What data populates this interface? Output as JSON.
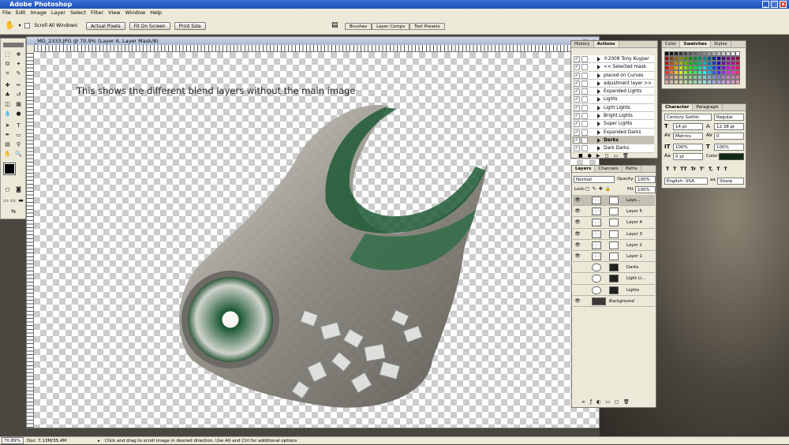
{
  "app": {
    "title": "Adobe Photoshop"
  },
  "menu": [
    "File",
    "Edit",
    "Image",
    "Layer",
    "Select",
    "Filter",
    "View",
    "Window",
    "Help"
  ],
  "options": {
    "scroll_all": "Scroll All Windows",
    "buttons": [
      "Actual Pixels",
      "Fit On Screen",
      "Print Size"
    ],
    "well_tabs": [
      "Brushes",
      "Layer Comps",
      "Tool Presets"
    ]
  },
  "document": {
    "title": "_MG_2333.JPG @ 70.9% (Layer 6, Layer Mask/8)",
    "caption": "This shows the different blend layers without the main image",
    "ruler_labels": [
      "0",
      "50",
      "100",
      "150",
      "200",
      "250",
      "300",
      "350",
      "400",
      "450",
      "500",
      "550",
      "600",
      "650",
      "700",
      "750",
      "800",
      "850",
      "900",
      "950",
      "1000",
      "1050",
      "1100",
      "1150",
      "1200",
      "1250",
      "1300",
      "1350",
      "1400",
      "1450",
      "1500",
      "1550",
      "1600",
      "1650"
    ]
  },
  "actions": {
    "tabs": [
      "History",
      "Actions"
    ],
    "items": [
      {
        "label": "©2008 Tony Kuyper",
        "checked": true
      },
      {
        "label": "<< Selected mask",
        "checked": true
      },
      {
        "label": "placed on Curves",
        "checked": true
      },
      {
        "label": "adjustment layer >>",
        "checked": true
      },
      {
        "label": "Expanded Lights",
        "checked": true
      },
      {
        "label": "Lights",
        "checked": true
      },
      {
        "label": "Light Lights",
        "checked": true
      },
      {
        "label": "Bright Lights",
        "checked": true
      },
      {
        "label": "Super Lights",
        "checked": true
      },
      {
        "label": "Expanded Darks",
        "checked": true
      },
      {
        "label": "Darks",
        "checked": true,
        "selected": true
      },
      {
        "label": "Dark Darks",
        "checked": true
      }
    ]
  },
  "swatches": {
    "tabs": [
      "Color",
      "Swatches",
      "Styles"
    ]
  },
  "character": {
    "tabs": [
      "Character",
      "Paragraph"
    ],
    "font": "Century Gothic",
    "style": "Regular",
    "size": "14 pt",
    "leading": "12.38 pt",
    "kerning": "Metrics",
    "tracking": "0",
    "vscale": "100%",
    "hscale": "100%",
    "baseline": "0 pt",
    "color_label": "Color:",
    "language": "English: USA",
    "antialias": "Sharp",
    "styles": [
      "T",
      "T",
      "TT",
      "Tr",
      "T'",
      "T,",
      "T",
      "T"
    ],
    "color": "#0f2b14"
  },
  "layers": {
    "tabs": [
      "Layers",
      "Channels",
      "Paths"
    ],
    "blend_mode": "Normal",
    "opacity_label": "Opacity:",
    "opacity": "100%",
    "lock_label": "Lock:",
    "fill_label": "Fill:",
    "fill": "100%",
    "items": [
      "Laye...",
      "Layer 5",
      "Layer 4",
      "Layer 3",
      "Layer 2",
      "Layer 1",
      "Darks",
      "Light Li...",
      "Lights",
      "Background"
    ]
  },
  "status": {
    "zoom": "70.89%",
    "doc": "Doc: 7.13M/35.4M",
    "hint": "Click and drag to scroll image in desired direction.  Use Alt and Ctrl for additional options"
  },
  "colors": {
    "accent": "#1c4fb8",
    "chrome": "#ece9d8",
    "photo_green": "#1f5a35"
  }
}
